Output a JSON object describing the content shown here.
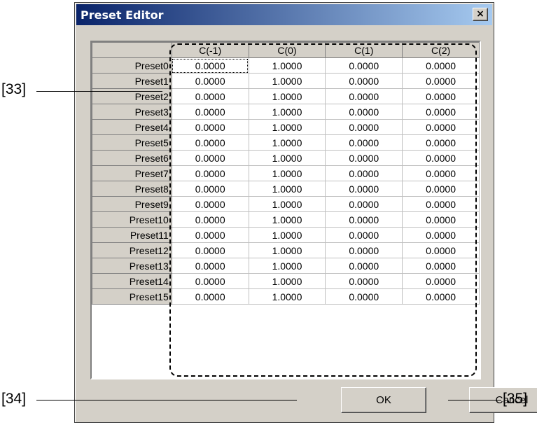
{
  "window": {
    "title": "Preset Editor",
    "close_glyph": "×"
  },
  "grid": {
    "columns": [
      "C(-1)",
      "C(0)",
      "C(1)",
      "C(2)"
    ],
    "rows": [
      {
        "label": "Preset0",
        "values": [
          "0.0000",
          "1.0000",
          "0.0000",
          "0.0000"
        ]
      },
      {
        "label": "Preset1",
        "values": [
          "0.0000",
          "1.0000",
          "0.0000",
          "0.0000"
        ]
      },
      {
        "label": "Preset2",
        "values": [
          "0.0000",
          "1.0000",
          "0.0000",
          "0.0000"
        ]
      },
      {
        "label": "Preset3",
        "values": [
          "0.0000",
          "1.0000",
          "0.0000",
          "0.0000"
        ]
      },
      {
        "label": "Preset4",
        "values": [
          "0.0000",
          "1.0000",
          "0.0000",
          "0.0000"
        ]
      },
      {
        "label": "Preset5",
        "values": [
          "0.0000",
          "1.0000",
          "0.0000",
          "0.0000"
        ]
      },
      {
        "label": "Preset6",
        "values": [
          "0.0000",
          "1.0000",
          "0.0000",
          "0.0000"
        ]
      },
      {
        "label": "Preset7",
        "values": [
          "0.0000",
          "1.0000",
          "0.0000",
          "0.0000"
        ]
      },
      {
        "label": "Preset8",
        "values": [
          "0.0000",
          "1.0000",
          "0.0000",
          "0.0000"
        ]
      },
      {
        "label": "Preset9",
        "values": [
          "0.0000",
          "1.0000",
          "0.0000",
          "0.0000"
        ]
      },
      {
        "label": "Preset10",
        "values": [
          "0.0000",
          "1.0000",
          "0.0000",
          "0.0000"
        ]
      },
      {
        "label": "Preset11",
        "values": [
          "0.0000",
          "1.0000",
          "0.0000",
          "0.0000"
        ]
      },
      {
        "label": "Preset12",
        "values": [
          "0.0000",
          "1.0000",
          "0.0000",
          "0.0000"
        ]
      },
      {
        "label": "Preset13",
        "values": [
          "0.0000",
          "1.0000",
          "0.0000",
          "0.0000"
        ]
      },
      {
        "label": "Preset14",
        "values": [
          "0.0000",
          "1.0000",
          "0.0000",
          "0.0000"
        ]
      },
      {
        "label": "Preset15",
        "values": [
          "0.0000",
          "1.0000",
          "0.0000",
          "0.0000"
        ]
      }
    ]
  },
  "buttons": {
    "ok": "OK",
    "cancel": "Cancel"
  },
  "callouts": {
    "c33": "[33]",
    "c34": "[34]",
    "c35": "[35]"
  }
}
